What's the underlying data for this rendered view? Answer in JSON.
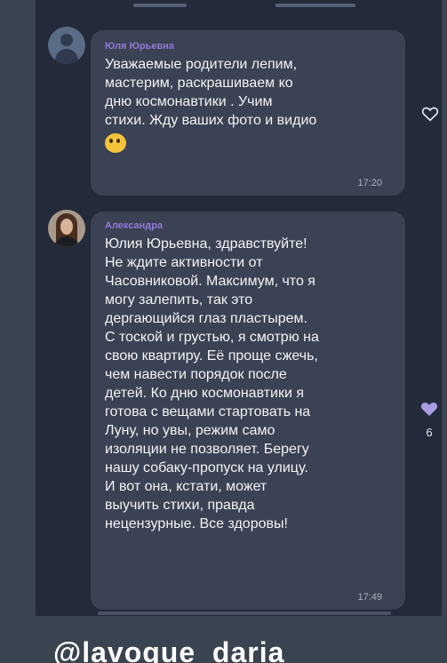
{
  "messages": [
    {
      "sender": "Юля Юрьевна",
      "text": "Уважаемые родители лепим,\nмастерим, раскрашиваем ко\nдню космонавтики . Учим\nстихи. Жду ваших фото и видио",
      "emoji_icon": "face-with-kiss-icon",
      "time": "17:20",
      "reaction": {
        "icon": "heart-outline-icon",
        "count": ""
      }
    },
    {
      "sender": "Александра",
      "text": "Юлия Юрьевна, здравствуйте!\nНе ждите активности от\nЧасовниковой. Максимум, что я\nмогу залепить, так это\nдергающийся глаз пластырем.\nС тоской и грустью, я смотрю на\nсвою квартиру. Её проще сжечь,\nчем навести порядок после\nдетей. Ко дню космонавтики я\nготова с вещами стартовать на\nЛуну, но увы, режим само\nизоляции не позволяет. Берегу\nнашу собаку-пропуск на улицу.\nИ вот она, кстати, может\nвыучить стихи, правда\nнецензурные. Все здоровы!",
      "time": "17:49",
      "reaction": {
        "icon": "heart-filled-icon",
        "count": "6",
        "color": "#a99be0"
      }
    }
  ],
  "watermark": "@lavogue_daria",
  "colors": {
    "background": "#3a4350",
    "chat_background": "#232a39",
    "bubble": "#3b4253",
    "sender_name": "#8e7bd6",
    "reaction_filled": "#a99be0"
  }
}
